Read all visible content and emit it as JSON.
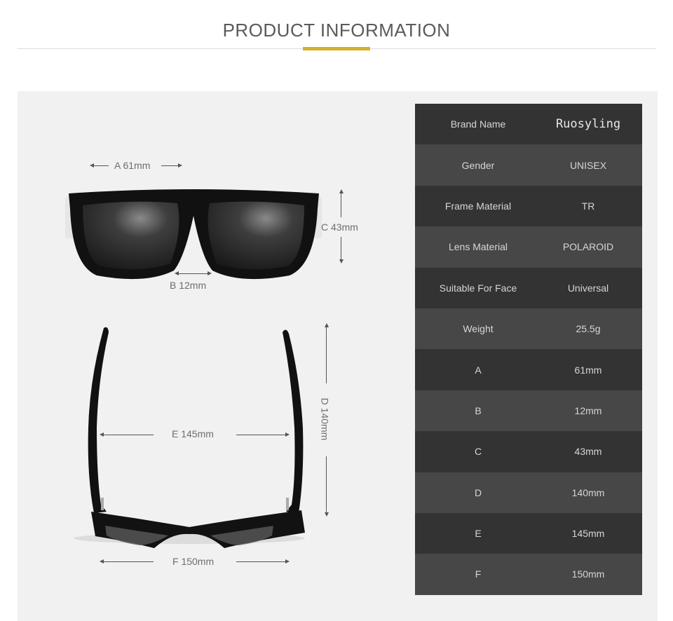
{
  "header": {
    "title": "PRODUCT INFORMATION",
    "accent_color": "#d4af2a"
  },
  "diagram": {
    "front_view": {
      "width_label": "A 61mm",
      "bridge_label": "B 12mm",
      "height_label": "C 43mm"
    },
    "top_view": {
      "temple_length_label": "D 140mm",
      "inner_width_label": "E 145mm",
      "total_width_label": "F 150mm"
    }
  },
  "specs": {
    "rows": [
      {
        "key": "Brand Name",
        "value": "Ruosyling"
      },
      {
        "key": "Gender",
        "value": "UNISEX"
      },
      {
        "key": "Frame Material",
        "value": "TR"
      },
      {
        "key": "Lens Material",
        "value": "POLAROID"
      },
      {
        "key": "Suitable For Face",
        "value": "Universal"
      },
      {
        "key": "Weight",
        "value": "25.5g"
      },
      {
        "key": "A",
        "value": "61mm"
      },
      {
        "key": "B",
        "value": "12mm"
      },
      {
        "key": "C",
        "value": "43mm"
      },
      {
        "key": "D",
        "value": "140mm"
      },
      {
        "key": "E",
        "value": "145mm"
      },
      {
        "key": "F",
        "value": "150mm"
      }
    ]
  }
}
